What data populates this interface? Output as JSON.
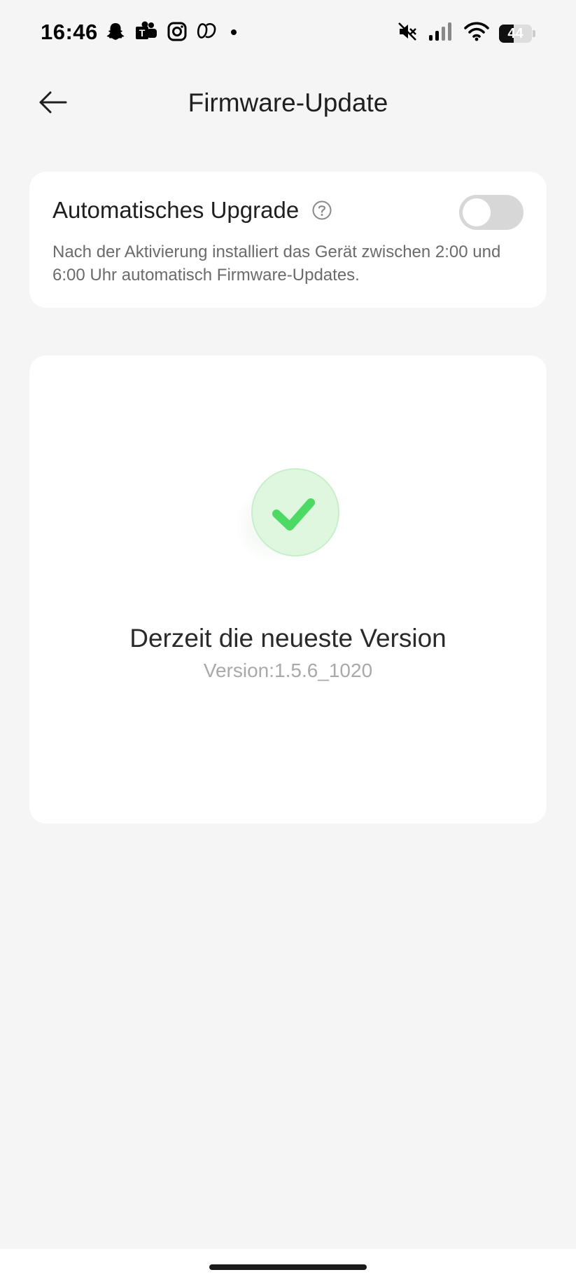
{
  "status_bar": {
    "time": "16:46",
    "battery_level": "44",
    "battery_fraction": 0.44,
    "notification_icons": [
      "snapchat-icon",
      "teams-icon",
      "instagram-icon",
      "app-icon",
      "dot-icon"
    ],
    "system_icons": [
      "mute-icon",
      "signal-icon",
      "wifi-icon",
      "battery-icon"
    ]
  },
  "header": {
    "title": "Firmware-Update",
    "back_icon": "arrow-left-icon"
  },
  "auto_upgrade": {
    "title": "Automatisches Upgrade",
    "help_icon": "question-circle-icon",
    "description": "Nach der Aktivierung installiert das Gerät zwischen 2:00 und 6:00 Uhr automatisch Firmware-Updates.",
    "enabled": false
  },
  "version_card": {
    "status_icon": "check-circle-icon",
    "status": "Derzeit die neueste Version",
    "version": "Version:1.5.6_1020"
  },
  "colors": {
    "background": "#f5f5f5",
    "card": "#ffffff",
    "accent_green": "#4cd964",
    "toggle_off": "#d7d7d7"
  }
}
